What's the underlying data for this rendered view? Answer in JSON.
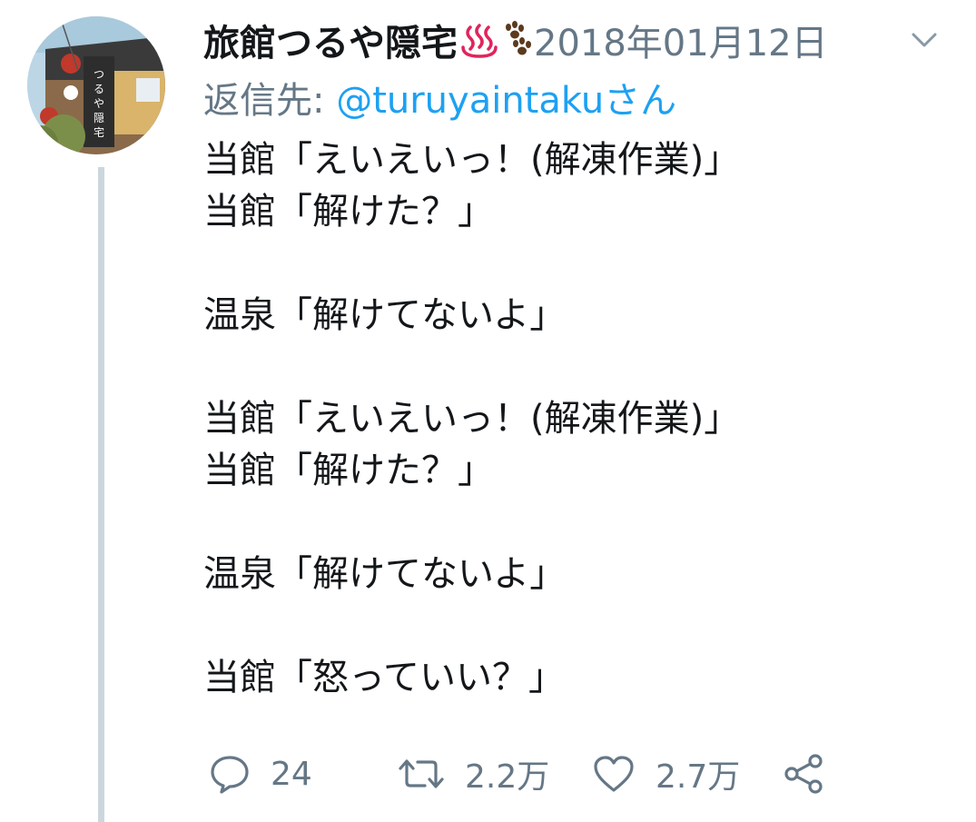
{
  "account": {
    "display_name": "旅館つるや隠宅",
    "name_emojis": [
      "hot-springs-icon",
      "paw-prints-icon"
    ],
    "avatar": "inn-building-photo"
  },
  "tweet": {
    "timestamp": "2018年01月12日",
    "reply_prefix": "返信先: ",
    "reply_handle": "@turuyaintakuさん",
    "lines": [
      "当館「えいえいっ！(解凍作業)」",
      "当館「解けた？」",
      "",
      "温泉「解けてないよ」",
      "",
      "当館「えいえいっ！(解凍作業)」",
      "当館「解けた？」",
      "",
      "温泉「解けてないよ」",
      "",
      "当館「怒っていい？」"
    ]
  },
  "actions": {
    "reply_count": "24",
    "retweet_count": "2.2万",
    "like_count": "2.7万"
  },
  "colors": {
    "text": "#14171a",
    "secondary": "#657786",
    "link": "#1da1f2",
    "thread_line": "#ccd6dd"
  }
}
